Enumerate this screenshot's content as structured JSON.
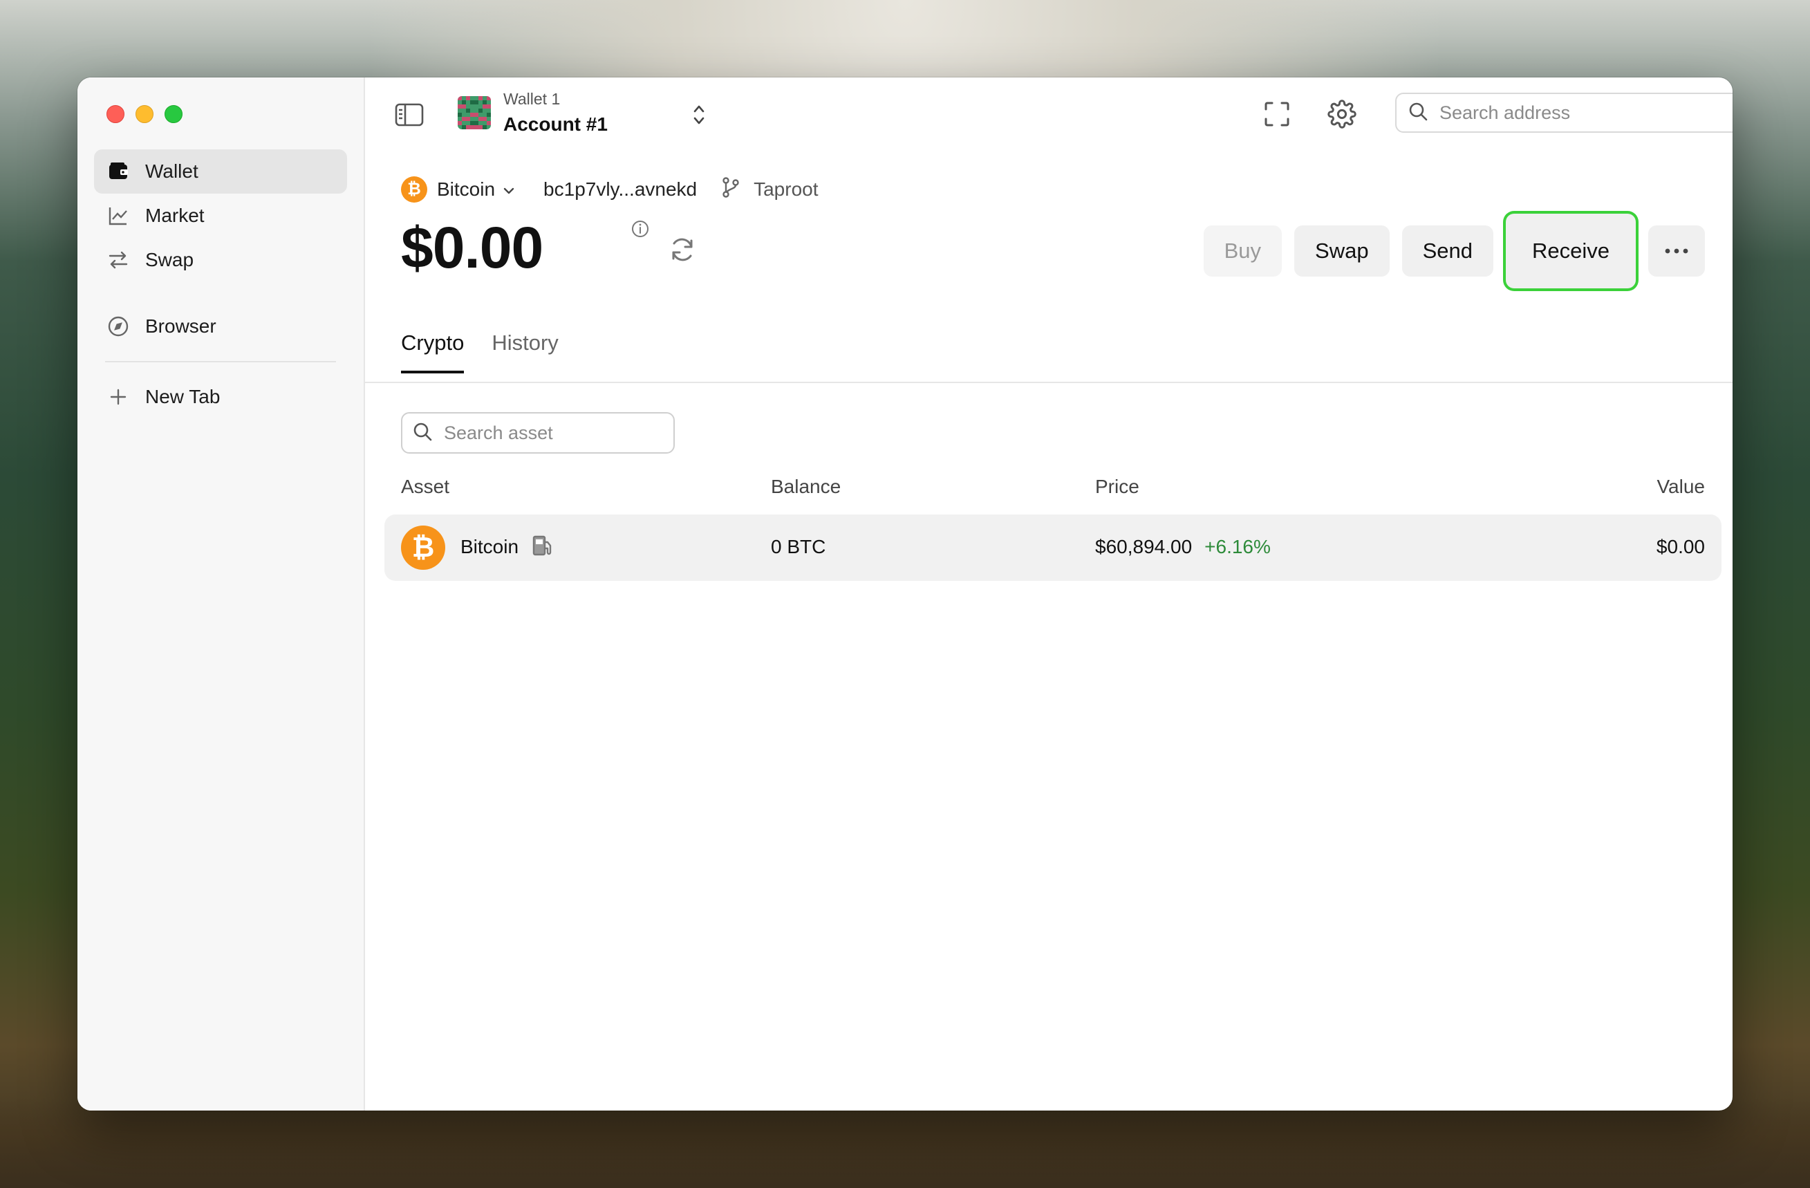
{
  "sidebar": {
    "items": [
      {
        "label": "Wallet",
        "icon": "wallet-icon",
        "active": true
      },
      {
        "label": "Market",
        "icon": "chart-icon"
      },
      {
        "label": "Swap",
        "icon": "swap-icon"
      },
      {
        "label": "Browser",
        "icon": "compass-icon"
      },
      {
        "label": "New Tab",
        "icon": "plus-icon"
      }
    ]
  },
  "header": {
    "wallet_name": "Wallet 1",
    "account_name": "Account #1",
    "search_placeholder": "Search address"
  },
  "chain": {
    "name": "Bitcoin",
    "address": "bc1p7vly...avnekd",
    "address_type": "Taproot"
  },
  "balance": "$0.00",
  "actions": {
    "buy": "Buy",
    "swap": "Swap",
    "send": "Send",
    "receive": "Receive",
    "more": "•••"
  },
  "tabs": [
    {
      "label": "Crypto",
      "active": true
    },
    {
      "label": "History"
    }
  ],
  "asset_search_placeholder": "Search asset",
  "table": {
    "columns": [
      "Asset",
      "Balance",
      "Price",
      "Value"
    ],
    "rows": [
      {
        "asset": "Bitcoin",
        "balance": "0 BTC",
        "price": "$60,894.00",
        "change": "+6.16%",
        "value": "$0.00"
      }
    ]
  },
  "colors": {
    "bitcoin": "#f7931a",
    "positive": "#2e8b3a",
    "highlight": "#3bd13a"
  }
}
